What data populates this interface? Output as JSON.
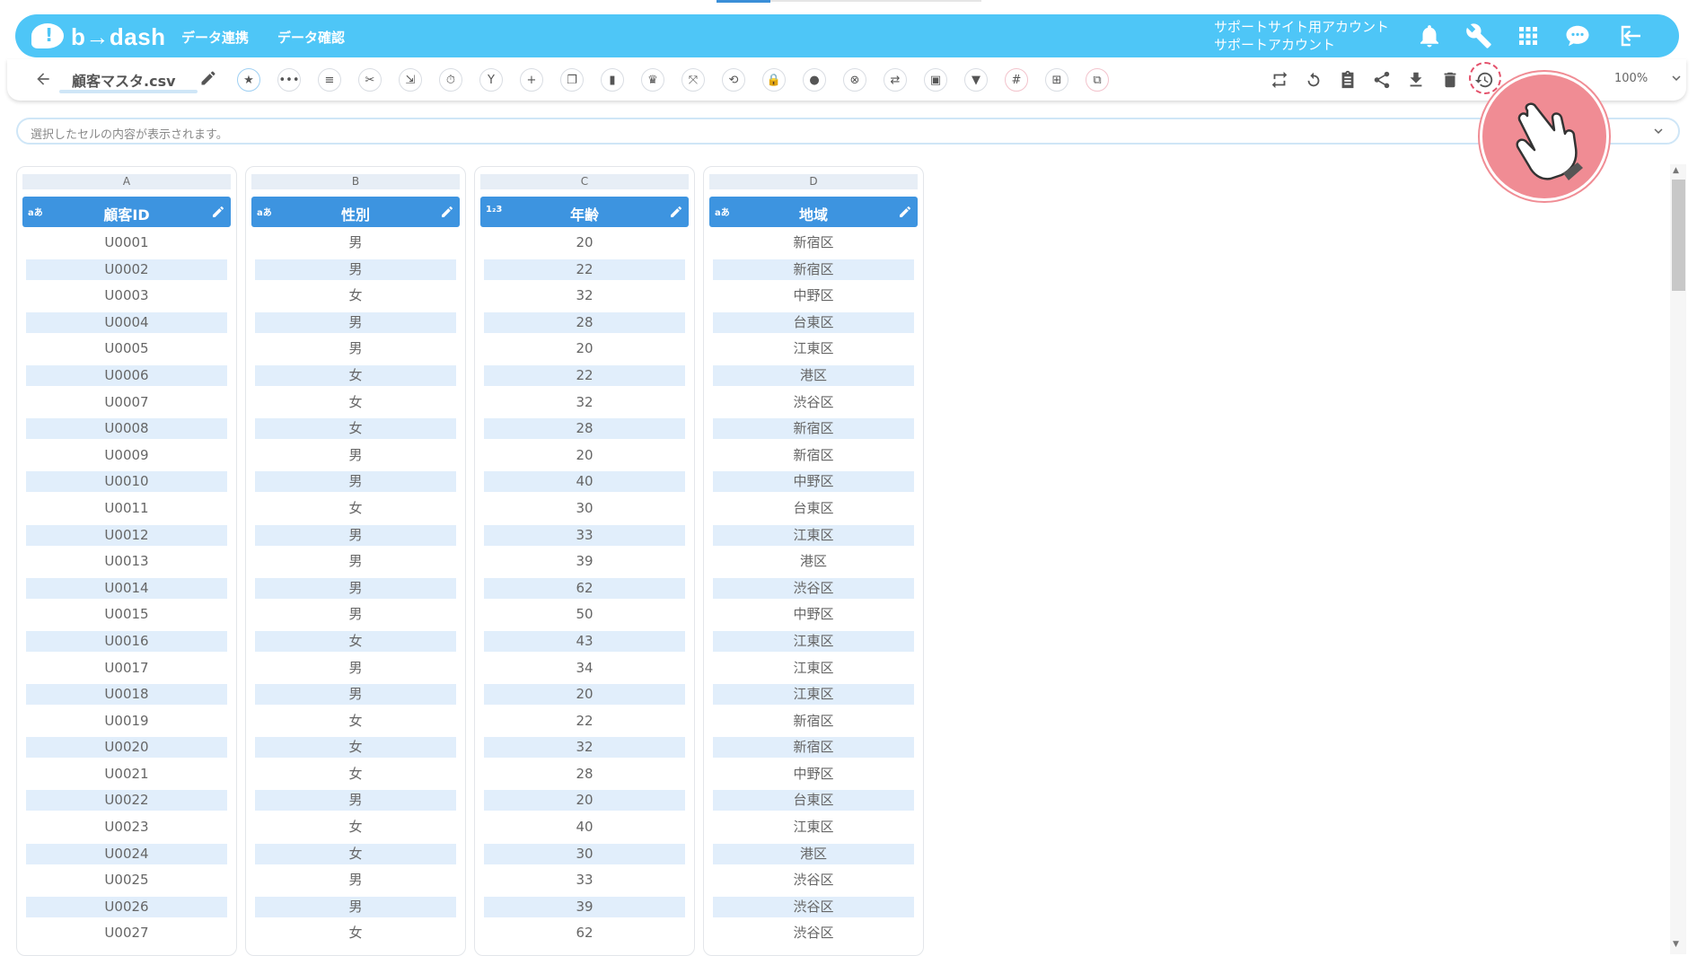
{
  "header": {
    "logo_text": "b→dash",
    "nav": [
      "データ連携",
      "データ確認"
    ],
    "account_line1": "サポートサイト用アカウント",
    "account_line2": "サポートアカウント",
    "icons": [
      "bell-icon",
      "wrench-icon",
      "grid-icon",
      "chat-bubble-icon",
      "logout-icon"
    ]
  },
  "toolbar": {
    "filename": "顧客マスタ.csv",
    "zoom": "100%",
    "left_tools": [
      "star-icon",
      "dots-icon",
      "list-icon",
      "scissors-icon",
      "merge-icon",
      "timer-icon",
      "branch-icon",
      "plus-icon",
      "copy-icon",
      "trash-icon",
      "crown-icon",
      "expand-icon",
      "loop-icon",
      "lock-icon",
      "bag-icon",
      "close-circle-icon",
      "replace-icon",
      "frame-icon",
      "filter-icon",
      "hash-icon",
      "table-icon",
      "split-icon"
    ],
    "right_tools": [
      "repeat-icon",
      "refresh-icon",
      "clipboard-icon",
      "share-icon",
      "download-icon",
      "delete-icon",
      "history-icon"
    ]
  },
  "cellbar": {
    "placeholder": "選択したセルの内容が表示されます。"
  },
  "columns": [
    {
      "letter": "A",
      "type": "aあ",
      "name": "顧客ID",
      "values": [
        "U0001",
        "U0002",
        "U0003",
        "U0004",
        "U0005",
        "U0006",
        "U0007",
        "U0008",
        "U0009",
        "U0010",
        "U0011",
        "U0012",
        "U0013",
        "U0014",
        "U0015",
        "U0016",
        "U0017",
        "U0018",
        "U0019",
        "U0020",
        "U0021",
        "U0022",
        "U0023",
        "U0024",
        "U0025",
        "U0026",
        "U0027"
      ]
    },
    {
      "letter": "B",
      "type": "aあ",
      "name": "性別",
      "values": [
        "男",
        "男",
        "女",
        "男",
        "男",
        "女",
        "女",
        "女",
        "男",
        "男",
        "女",
        "男",
        "男",
        "男",
        "男",
        "女",
        "男",
        "男",
        "女",
        "女",
        "女",
        "男",
        "女",
        "女",
        "男",
        "男",
        "女"
      ]
    },
    {
      "letter": "C",
      "type": "1₂3",
      "name": "年齢",
      "values": [
        "20",
        "22",
        "32",
        "28",
        "20",
        "22",
        "32",
        "28",
        "20",
        "40",
        "30",
        "33",
        "39",
        "62",
        "50",
        "43",
        "34",
        "20",
        "22",
        "32",
        "28",
        "20",
        "40",
        "30",
        "33",
        "39",
        "62"
      ]
    },
    {
      "letter": "D",
      "type": "aあ",
      "name": "地域",
      "values": [
        "新宿区",
        "新宿区",
        "中野区",
        "台東区",
        "江東区",
        "港区",
        "渋谷区",
        "新宿区",
        "新宿区",
        "中野区",
        "台東区",
        "江東区",
        "港区",
        "渋谷区",
        "中野区",
        "江東区",
        "江東区",
        "江東区",
        "新宿区",
        "新宿区",
        "中野区",
        "台東区",
        "江東区",
        "港区",
        "渋谷区",
        "渋谷区",
        "渋谷区"
      ]
    }
  ],
  "colors": {
    "header_bg": "#4ec6f7",
    "column_header": "#3d94e0",
    "row_alt": "#e1eefb",
    "pointer": "#f08c94"
  }
}
